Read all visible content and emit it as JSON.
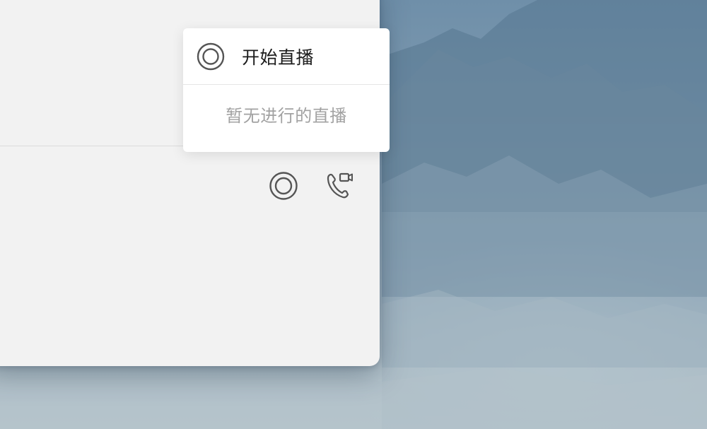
{
  "popover": {
    "start_live_label": "开始直播",
    "start_live_icon": "live-record-icon",
    "empty_message": "暂无进行的直播"
  },
  "toolbar": {
    "icons": [
      "live-record-icon",
      "video-call-icon"
    ]
  },
  "colors": {
    "window_bg": "#f2f2f2",
    "popover_bg": "#ffffff",
    "icon_stroke": "#555555",
    "label_text": "#1b1b1b",
    "muted_text": "#a2a2a2"
  }
}
